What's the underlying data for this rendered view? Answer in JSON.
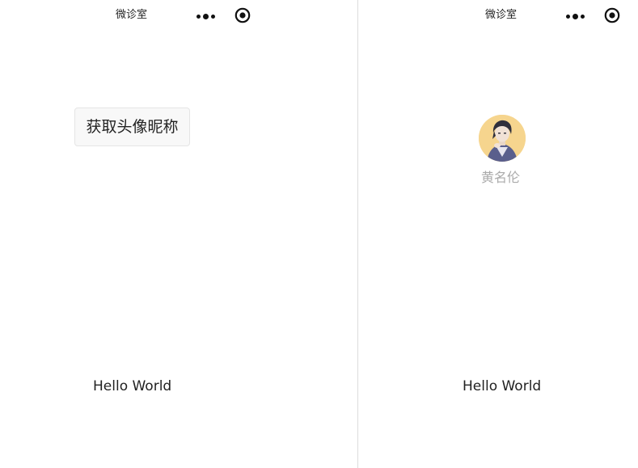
{
  "left_screen": {
    "nav": {
      "title": "微诊室",
      "more_icon": "more-dots-icon",
      "close_icon": "target-circle-icon"
    },
    "auth_button_label": "获取头像昵称",
    "footer_text": "Hello World"
  },
  "right_screen": {
    "nav": {
      "title": "微诊室",
      "more_icon": "more-dots-icon",
      "close_icon": "target-circle-icon"
    },
    "avatar_icon": "user-avatar",
    "nickname": "黄名伦",
    "footer_text": "Hello World"
  },
  "colors": {
    "text": "#222222",
    "nickname": "#aaaaaa",
    "button_bg": "#f8f8f8",
    "divider": "#dcdcdc",
    "avatar_bg": "#f6d58e"
  }
}
